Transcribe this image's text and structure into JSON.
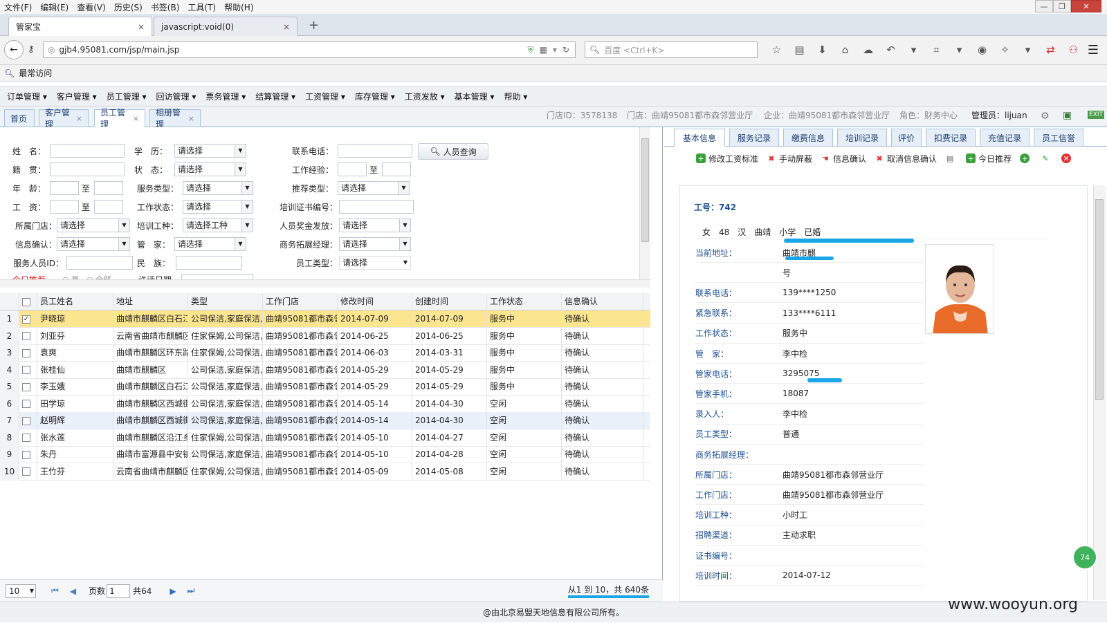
{
  "browser": {
    "menu": [
      "文件(F)",
      "编辑(E)",
      "查看(V)",
      "历史(S)",
      "书签(B)",
      "工具(T)",
      "帮助(H)"
    ],
    "tabs": [
      {
        "title": "管家宝",
        "close": "×"
      },
      {
        "title": "javascript:void(0)",
        "close": "×"
      }
    ],
    "new_tab": "+",
    "url": "gjb4.95081.com/jsp/main.jsp",
    "search_placeholder": "百度 <Ctrl+K>",
    "bookmark": "最常访问"
  },
  "app_menu": [
    "订单管理 ▾",
    "客户管理 ▾",
    "员工管理 ▾",
    "回访管理 ▾",
    "票务管理 ▾",
    "结算管理 ▾",
    "工资管理 ▾",
    "库存管理 ▾",
    "工资发放 ▾",
    "基本管理 ▾",
    "帮助 ▾"
  ],
  "app_tabs": [
    {
      "label": "首页",
      "close": ""
    },
    {
      "label": "客户管理",
      "close": "×"
    },
    {
      "label": "员工管理",
      "close": "×"
    },
    {
      "label": "相册管理",
      "close": "×"
    }
  ],
  "info": {
    "store_id": "门店ID：3578138",
    "store": "门店：曲靖95081都市森邻营业厅",
    "company": "企业：曲靖95081都市森邻营业厅",
    "role": "角色：财务中心",
    "admin": "管理员：lijuan"
  },
  "form": {
    "name": "姓　名：",
    "edu": "学　历：",
    "phone": "联系电话：",
    "query_btn": "人员查询",
    "origin": "籍　贯：",
    "status": "状　态：",
    "exp": "工作经验：",
    "to": "至",
    "age": "年　龄：",
    "service_type": "服务类型：",
    "rec_type": "推荐类型：",
    "wage": "工　资：",
    "work_status": "工作状态：",
    "cert_no": "培训证书编号：",
    "store": "所属门店：",
    "train_type": "培训工种：",
    "bonus": "人员奖金发放：",
    "info_confirm": "信息确认：",
    "butler": "管　家：",
    "bd_manager": "商务拓展经理：",
    "staff_id": "服务人员ID：",
    "nation": "民　族：",
    "staff_type": "员工类型：",
    "please_select": "请选择",
    "please_select_train": "请选择工种",
    "cut_row_1": "今日推荐",
    "cut_row_2": "○ 是　○ 全部",
    "cut_row_3": "许话日期"
  },
  "grid": {
    "headers": [
      "员工姓名",
      "地址",
      "类型",
      "工作门店",
      "修改时间",
      "创建时间",
      "工作状态",
      "信息确认"
    ],
    "rows": [
      [
        "1",
        "✓",
        "尹晓琼",
        "曲靖市麒麟区白石江",
        "公司保洁,家庭保洁,",
        "曲靖95081都市森邻",
        "2014-07-09",
        "2014-07-09",
        "服务中",
        "待确认"
      ],
      [
        "2",
        "",
        "刘亚芬",
        "云南省曲靖市麒麟区",
        "住家保姆,公司保洁,",
        "曲靖95081都市森邻",
        "2014-06-25",
        "2014-06-25",
        "服务中",
        "待确认"
      ],
      [
        "3",
        "",
        "袁爽",
        "曲靖市麒麟区环东路",
        "住家保姆,公司保洁,",
        "曲靖95081都市森邻",
        "2014-06-03",
        "2014-03-31",
        "服务中",
        "待确认"
      ],
      [
        "4",
        "",
        "张桂仙",
        "曲靖市麒麟区",
        "公司保洁,家庭保洁,",
        "曲靖95081都市森邻",
        "2014-05-29",
        "2014-05-29",
        "服务中",
        "待确认"
      ],
      [
        "5",
        "",
        "李玉娥",
        "曲靖市麒麟区白石江",
        "公司保洁,家庭保洁,",
        "曲靖95081都市森邻",
        "2014-05-29",
        "2014-05-29",
        "服务中",
        "待确认"
      ],
      [
        "6",
        "",
        "田学琼",
        "曲靖市麒麟区西城街",
        "公司保洁,家庭保洁,",
        "曲靖95081都市森邻",
        "2014-05-14",
        "2014-04-30",
        "空闲",
        "待确认"
      ],
      [
        "7",
        "",
        "赵明辉",
        "曲靖市麒麟区西城街",
        "公司保洁,家庭保洁,",
        "曲靖95081都市森邻",
        "2014-05-14",
        "2014-04-30",
        "空闲",
        "待确认"
      ],
      [
        "8",
        "",
        "张水莲",
        "曲靖市麒麟区沿江乡",
        "住家保姆,公司保洁,",
        "曲靖95081都市森邻",
        "2014-05-10",
        "2014-04-27",
        "空闲",
        "待确认"
      ],
      [
        "9",
        "",
        "朱丹",
        "曲靖市富源县中安镇",
        "公司保洁,家庭保洁,",
        "曲靖95081都市森邻",
        "2014-05-10",
        "2014-04-28",
        "空闲",
        "待确认"
      ],
      [
        "10",
        "",
        "王竹芬",
        "云南省曲靖市麒麟区",
        "住家保姆,公司保洁,",
        "曲靖95081都市森邻",
        "2014-05-09",
        "2014-05-08",
        "空闲",
        "待确认"
      ]
    ]
  },
  "pager": {
    "page_size": "10",
    "page_label": "页数",
    "page": "1",
    "total_pages": "共64",
    "summary": "从1 到 10，共 640条"
  },
  "detail": {
    "tabs": [
      "基本信息",
      "服务记录",
      "缴费信息",
      "培训记录",
      "评价",
      "扣费记录",
      "充值记录",
      "员工信誉"
    ],
    "actions": [
      "修改工资标准",
      "手动屏蔽",
      "信息确认",
      "取消信息确认",
      "今日推荐"
    ],
    "title": "工号：742",
    "summary": "女　48　汉　曲靖　小学　已婚",
    "fields": [
      {
        "k": "当前地址：",
        "v": "曲靖市麒"
      },
      {
        "k": "",
        "v": "号"
      },
      {
        "k": "联系电话：",
        "v": "139****1250"
      },
      {
        "k": "紧急联系：",
        "v": "133****6111"
      },
      {
        "k": "工作状态：",
        "v": "服务中"
      },
      {
        "k": "管　家：",
        "v": "李中检"
      },
      {
        "k": "管家电话：",
        "v": "3295075"
      },
      {
        "k": "管家手机：",
        "v": "18087"
      },
      {
        "k": "录入人：",
        "v": "李中检"
      },
      {
        "k": "员工类型：",
        "v": "普通"
      },
      {
        "k": "商务拓展经理：",
        "v": ""
      },
      {
        "k": "所属门店：",
        "v": "曲靖95081都市森邻营业厅"
      },
      {
        "k": "工作门店：",
        "v": "曲靖95081都市森邻营业厅"
      },
      {
        "k": "培训工种：",
        "v": "小时工"
      },
      {
        "k": "招聘渠道：",
        "v": "主动求职"
      },
      {
        "k": "证书编号：",
        "v": ""
      },
      {
        "k": "培训时间：",
        "v": "2014-07-12"
      }
    ]
  },
  "footer": "@由北京易盟天地信息有限公司所有。",
  "watermark": "www.wooyun.org",
  "colors": {
    "selected_row": "#fbe58e",
    "redaction": "#1aa6e6",
    "link_blue": "#1b4e8e"
  }
}
